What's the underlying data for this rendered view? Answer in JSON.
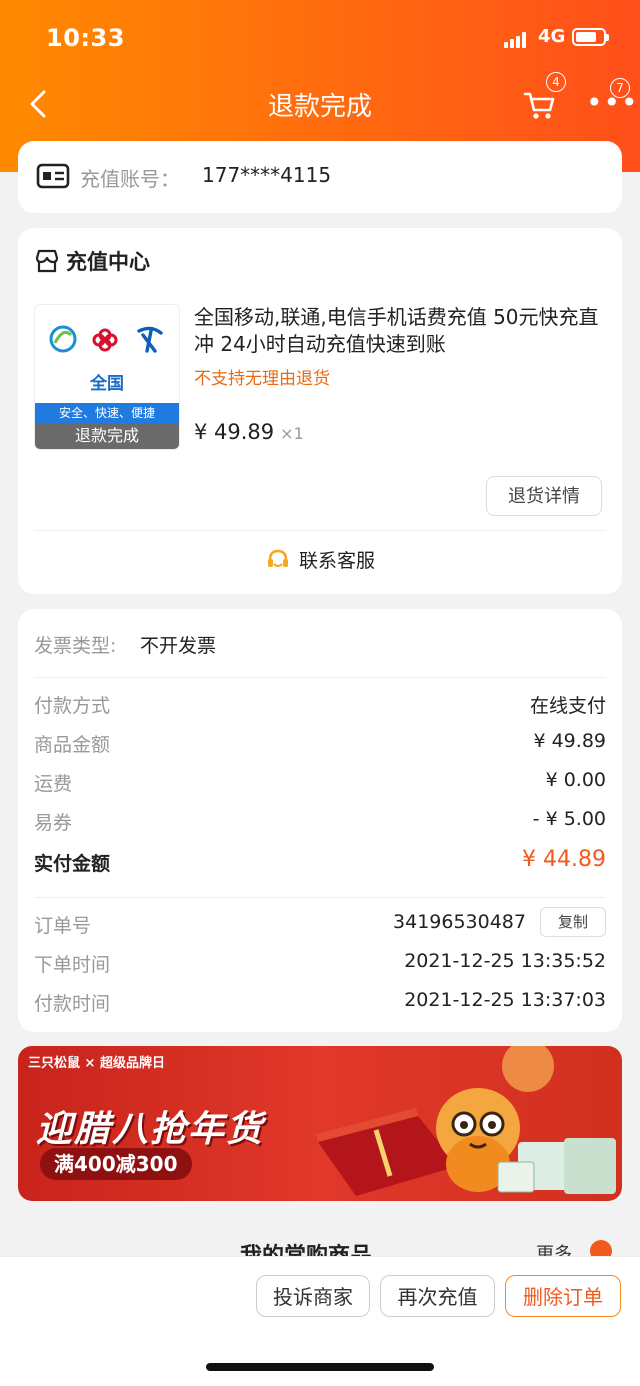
{
  "status_bar": {
    "time": "10:33",
    "network": "4G"
  },
  "nav": {
    "title": "退款完成",
    "cart_badge": "4",
    "more_badge": "7"
  },
  "account": {
    "label": "充值账号：",
    "value": "177****4115"
  },
  "shop": {
    "name": "充值中心",
    "product": {
      "thumb_region": "全国",
      "thumb_tagline": "安全、快速、便捷",
      "thumb_status": "退款完成",
      "title": "全国移动,联通,电信手机话费充值 50元快充直冲 24小时自动充值快速到账",
      "warning": "不支持无理由退货",
      "price": "¥ 49.89",
      "qty": "×1"
    },
    "detail_button": "退货详情",
    "service_button": "联系客服"
  },
  "invoice": {
    "label": "发票类型:",
    "value": "不开发票"
  },
  "payment": {
    "rows": [
      {
        "label": "付款方式",
        "value": "在线支付"
      },
      {
        "label": "商品金额",
        "value": "¥ 49.89"
      },
      {
        "label": "运费",
        "value": "¥ 0.00"
      },
      {
        "label": "易券",
        "value": "- ¥ 5.00"
      }
    ],
    "total_label": "实付金额",
    "total_value": "¥ 44.89"
  },
  "order": {
    "id_label": "订单号",
    "id_value": "34196530487",
    "copy_button": "复制",
    "created_label": "下单时间",
    "created_value": "2021-12-25 13:35:52",
    "paid_label": "付款时间",
    "paid_value": "2021-12-25 13:37:03"
  },
  "banner": {
    "brand": "三只松鼠 × 超级品牌日",
    "headline": "迎腊八抢年货",
    "promo": "满400减300"
  },
  "recommend": {
    "title": "我的常购商品",
    "more": "更多"
  },
  "actions": {
    "complain": "投诉商家",
    "recharge": "再次充值",
    "delete": "删除订单"
  },
  "colors": {
    "header": "#ff7a0a",
    "accent": "#f25a1c",
    "warning": "#e96a12"
  }
}
